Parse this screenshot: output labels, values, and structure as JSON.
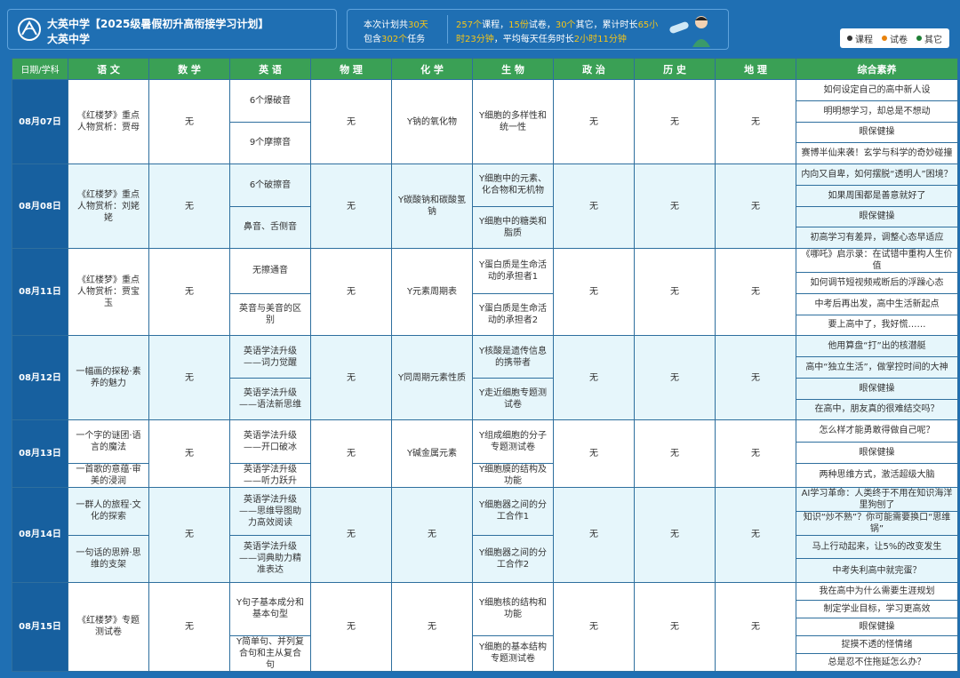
{
  "header": {
    "title_line1": "大英中学【2025级暑假初升高衔接学习计划】",
    "title_line2": "大英中学",
    "stat_days_prefix": "本次计划共",
    "stat_days": "30天",
    "stat_tasks_prefix": "包含",
    "stat_tasks": "302个",
    "stat_tasks_suffix": "任务",
    "courses": "257个",
    "courses_label": "课程，",
    "papers": "15份",
    "papers_label": "试卷，",
    "others": "30个",
    "others_label": "其它，累计时长",
    "total_time_a": "65小",
    "total_time_b": "时23分钟",
    "avg_label": "，平均每天任务时长",
    "avg_time": "2小时11分钟",
    "legend": [
      {
        "label": "课程",
        "color": "#333333"
      },
      {
        "label": "试卷",
        "color": "#e8820c"
      },
      {
        "label": "其它",
        "color": "#1e7e34"
      }
    ]
  },
  "columns": [
    "日期/学科",
    "语 文",
    "数 学",
    "英 语",
    "物 理",
    "化 学",
    "生 物",
    "政 治",
    "历 史",
    "地 理",
    "综合素养"
  ],
  "none": "无",
  "days": [
    {
      "date": "08月07日",
      "chinese": [
        {
          "t": "《红楼梦》重点人物赏析：贾母",
          "c": "dark"
        }
      ],
      "english": [
        "6个爆破音",
        "9个摩擦音"
      ],
      "chemistry": "Y钠的氧化物",
      "biology": [
        {
          "t": "Y细胞的多样性和统一性",
          "c": "dark"
        }
      ],
      "quality": [
        {
          "t": "如何设定自己的高中新人设",
          "c": "dark"
        },
        {
          "t": "明明想学习，却总是不想动",
          "c": "green"
        },
        {
          "t": "眼保健操",
          "c": "dark"
        },
        {
          "t": "赛博半仙来袭！玄学与科学的奇妙碰撞",
          "c": "dark"
        }
      ]
    },
    {
      "date": "08月08日",
      "chinese": [
        {
          "t": "《红楼梦》重点人物赏析：刘姥姥",
          "c": "dark"
        }
      ],
      "english": [
        "6个破擦音",
        "鼻音、舌侧音"
      ],
      "chemistry": "Y碳酸钠和碳酸氢钠",
      "biology": [
        {
          "t": "Y细胞中的元素、化合物和无机物",
          "c": "dark"
        },
        {
          "t": "Y细胞中的糖类和脂质",
          "c": "dark"
        }
      ],
      "quality": [
        {
          "t": "内向又自卑，如何摆脱“透明人”困境？",
          "c": "green"
        },
        {
          "t": "如果周围都是善意就好了",
          "c": "green"
        },
        {
          "t": "眼保健操",
          "c": "dark"
        },
        {
          "t": "初高学习有差异，调整心态早适应",
          "c": "dark"
        }
      ]
    },
    {
      "date": "08月11日",
      "chinese": [
        {
          "t": "《红楼梦》重点人物赏析：贾宝玉",
          "c": "dark"
        }
      ],
      "english": [
        "无擦通音",
        "英音与美音的区别"
      ],
      "chemistry": "Y元素周期表",
      "biology": [
        {
          "t": "Y蛋白质是生命活动的承担者1",
          "c": "dark"
        },
        {
          "t": "Y蛋白质是生命活动的承担者2",
          "c": "dark"
        }
      ],
      "quality": [
        {
          "t": "《哪吒》启示录：在试错中重构人生价值",
          "c": "dark"
        },
        {
          "t": "如何调节短视频戒断后的浮躁心态",
          "c": "green"
        },
        {
          "t": "中考后再出发，高中生活新起点",
          "c": "dark"
        },
        {
          "t": "要上高中了，我好慌……",
          "c": "green"
        }
      ]
    },
    {
      "date": "08月12日",
      "chinese": [
        {
          "t": "一幅画的探秘·素养的魅力",
          "c": "dark"
        }
      ],
      "english": [
        "英语学法升级——词力觉醒",
        "英语学法升级——语法新思维"
      ],
      "chemistry": "Y同周期元素性质",
      "biology": [
        {
          "t": "Y核酸是遗传信息的携带者",
          "c": "dark"
        },
        {
          "t": "Y走近细胞专题测试卷",
          "c": "orange"
        }
      ],
      "quality": [
        {
          "t": "他用算盘“打”出的核潜艇",
          "c": "dark"
        },
        {
          "t": "高中“独立生活”，做掌控时间的大神",
          "c": "dark"
        },
        {
          "t": "眼保健操",
          "c": "dark"
        },
        {
          "t": "在高中，朋友真的很难结交吗？",
          "c": "green"
        }
      ]
    },
    {
      "date": "08月13日",
      "chinese": [
        {
          "t": "一个字的谜团·语言的魔法",
          "c": "dark"
        },
        {
          "t": "一首歌的意蕴·审美的浸润",
          "c": "dark"
        }
      ],
      "english": [
        "英语学法升级——开口破冰",
        "英语学法升级——听力跃升"
      ],
      "chemistry": "Y碱金属元素",
      "biology": [
        {
          "t": "Y组成细胞的分子专题测试卷",
          "c": "orange"
        },
        {
          "t": "Y细胞膜的结构及功能",
          "c": "dark"
        }
      ],
      "quality": [
        {
          "t": "怎么样才能勇敢得做自己呢？",
          "c": "green"
        },
        {
          "t": "眼保健操",
          "c": "dark"
        },
        {
          "t": "两种思维方式，激活超级大脑",
          "c": "dark"
        }
      ]
    },
    {
      "date": "08月14日",
      "chinese": [
        {
          "t": "一群人的旅程·文化的探索",
          "c": "dark"
        },
        {
          "t": "一句话的思辨·思维的支架",
          "c": "dark"
        }
      ],
      "english": [
        "英语学法升级——思维导图助力高效阅读",
        "英语学法升级——词典助力精准表达"
      ],
      "chemistry": "无",
      "biology": [
        {
          "t": "Y细胞器之间的分工合作1",
          "c": "dark"
        },
        {
          "t": "Y细胞器之间的分工合作2",
          "c": "dark"
        }
      ],
      "quality": [
        {
          "t": "AI学习革命：人类终于不用在知识海洋里狗刨了",
          "c": "dark"
        },
        {
          "t": "知识“炒不熟”？你可能需要换口“思维锅”",
          "c": "green"
        },
        {
          "t": "马上行动起来，让5%的改变发生",
          "c": "dark"
        },
        {
          "t": "中考失利高中就完蛋？",
          "c": "green"
        }
      ]
    },
    {
      "date": "08月15日",
      "chinese": [
        {
          "t": "《红楼梦》专题测试卷",
          "c": "orange"
        }
      ],
      "english": [
        "Y句子基本成分和基本句型",
        "Y简单句、并列复合句和主从复合句"
      ],
      "chemistry": "无",
      "biology": [
        {
          "t": "Y细胞核的结构和功能",
          "c": "dark"
        },
        {
          "t": "Y细胞的基本结构专题测试卷",
          "c": "orange"
        }
      ],
      "quality": [
        {
          "t": "我在高中为什么需要生涯规划",
          "c": "dark"
        },
        {
          "t": "制定学业目标，学习更高效",
          "c": "dark"
        },
        {
          "t": "眼保健操",
          "c": "dark"
        },
        {
          "t": "捉摸不透的怪情绪",
          "c": "green"
        },
        {
          "t": "总是忍不住拖延怎么办？",
          "c": "green"
        }
      ]
    }
  ]
}
